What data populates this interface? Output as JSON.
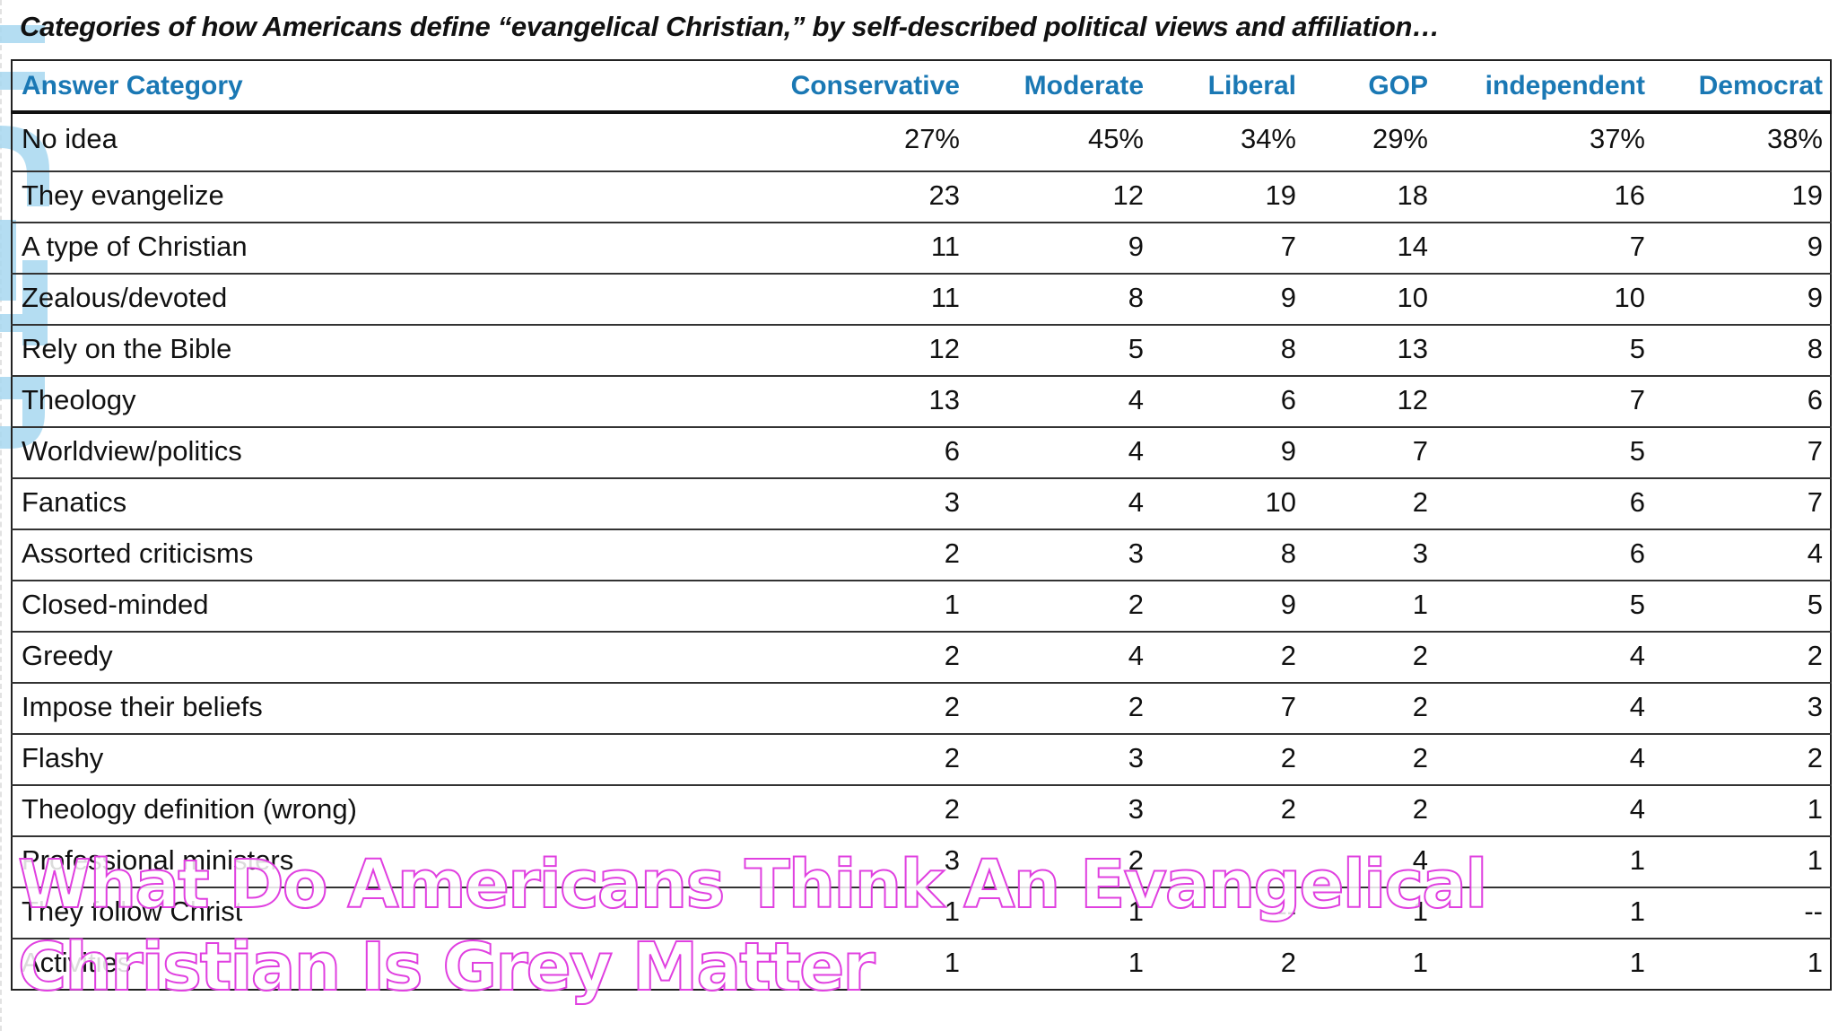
{
  "title": "Categories of how Americans define “evangelical Christian,” by self-described political views and affiliation…",
  "table": {
    "headers": [
      "Answer Category",
      "Conservative",
      "Moderate",
      "Liberal",
      "GOP",
      "independent",
      "Democrat"
    ],
    "rows": [
      [
        "No idea",
        "27%",
        "45%",
        "34%",
        "29%",
        "37%",
        "38%"
      ],
      [
        "They evangelize",
        "23",
        "12",
        "19",
        "18",
        "16",
        "19"
      ],
      [
        "A type of Christian",
        "11",
        "9",
        "7",
        "14",
        "7",
        "9"
      ],
      [
        "Zealous/devoted",
        "11",
        "8",
        "9",
        "10",
        "10",
        "9"
      ],
      [
        "Rely on the Bible",
        "12",
        "5",
        "8",
        "13",
        "5",
        "8"
      ],
      [
        "Theology",
        "13",
        "4",
        "6",
        "12",
        "7",
        "6"
      ],
      [
        "Worldview/politics",
        "6",
        "4",
        "9",
        "7",
        "5",
        "7"
      ],
      [
        "Fanatics",
        "3",
        "4",
        "10",
        "2",
        "6",
        "7"
      ],
      [
        "Assorted criticisms",
        "2",
        "3",
        "8",
        "3",
        "6",
        "4"
      ],
      [
        "Closed-minded",
        "1",
        "2",
        "9",
        "1",
        "5",
        "5"
      ],
      [
        "Greedy",
        "2",
        "4",
        "2",
        "2",
        "4",
        "2"
      ],
      [
        "Impose their beliefs",
        "2",
        "2",
        "7",
        "2",
        "4",
        "3"
      ],
      [
        "Flashy",
        "2",
        "3",
        "2",
        "2",
        "4",
        "2"
      ],
      [
        "Theology definition (wrong)",
        "2",
        "3",
        "2",
        "2",
        "4",
        "1"
      ],
      [
        "Professional ministers",
        "3",
        "2",
        "",
        "4",
        "1",
        "1"
      ],
      [
        "They follow Christ",
        "1",
        "1",
        "--",
        "1",
        "1",
        "--"
      ],
      [
        "Activities",
        "1",
        "1",
        "2",
        "1",
        "1",
        "1"
      ]
    ]
  },
  "watermark": {
    "line1": "What Do Americans Think An Evangelical",
    "line2": "Christian Is Grey Matter"
  },
  "colors": {
    "header_text": "#1a78b4",
    "watermark_outline": "#e040e0",
    "deco_blue": "#a8d8f0"
  }
}
